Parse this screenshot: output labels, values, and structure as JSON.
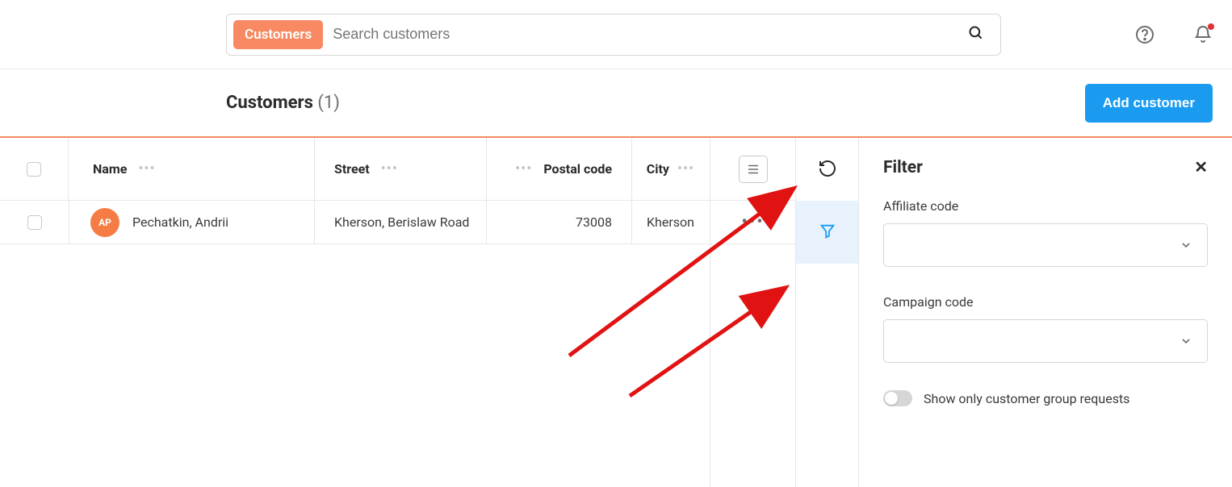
{
  "search": {
    "tag": "Customers",
    "placeholder": "Search customers"
  },
  "header": {
    "title": "Customers",
    "count": "(1)",
    "add_btn": "Add customer"
  },
  "table": {
    "columns": {
      "name": "Name",
      "street": "Street",
      "postal": "Postal code",
      "city": "City"
    },
    "rows": [
      {
        "avatar": "AP",
        "name": "Pechatkin, Andrii",
        "street": "Kherson, Berislaw Road",
        "postal": "73008",
        "city": "Kherson"
      }
    ]
  },
  "filter": {
    "title": "Filter",
    "affiliate_label": "Affiliate code",
    "campaign_label": "Campaign code",
    "toggle_label": "Show only customer group requests"
  },
  "colors": {
    "accent_orange": "#f88962",
    "accent_blue": "#1a9bf0",
    "annotation_red": "#e11212"
  }
}
